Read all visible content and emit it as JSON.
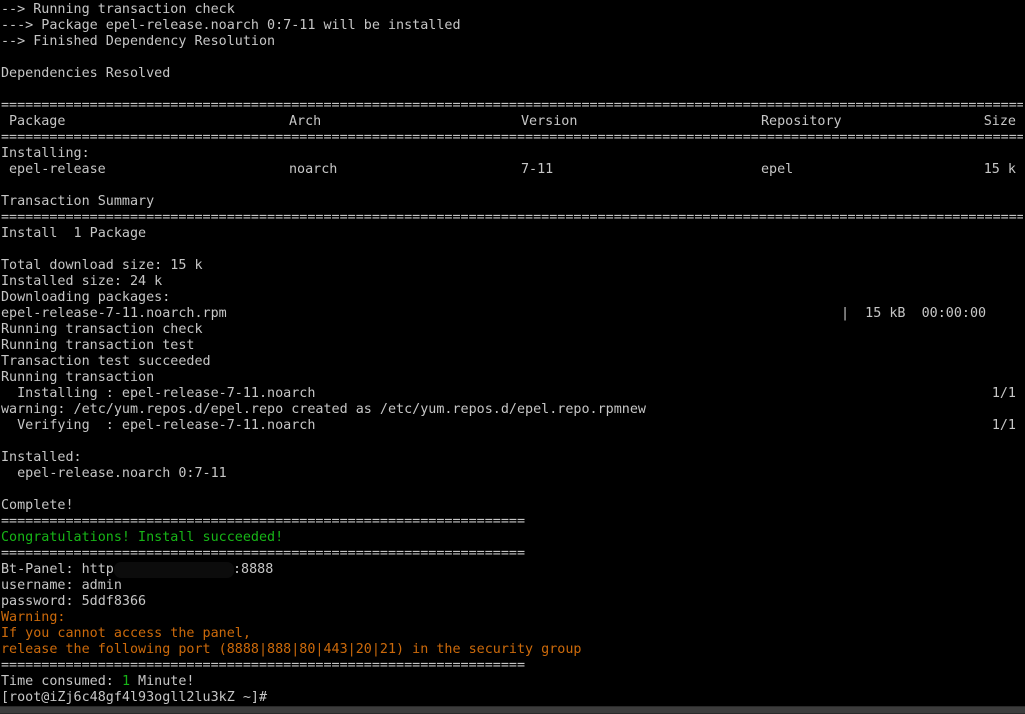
{
  "terminal": {
    "lines": {
      "l1": "--> Running transaction check",
      "l2": "---> Package epel-release.noarch 0:7-11 will be installed",
      "l3": "--> Finished Dependency Resolution",
      "l4": "Dependencies Resolved",
      "rule_double": "================================================================================================================================================================",
      "rule_short": "=================================================================",
      "installing_hdr": "Installing:",
      "transaction_summary": "Transaction Summary",
      "install_count": "Install  1 Package",
      "total_download": "Total download size: 15 k",
      "installed_size": "Installed size: 24 k",
      "downloading": "Downloading packages:",
      "rpm_file": "epel-release-7-11.noarch.rpm",
      "rpm_progress": "|  15 kB  00:00:00",
      "run_check": "Running transaction check",
      "run_test": "Running transaction test",
      "test_ok": "Transaction test succeeded",
      "running": "Running transaction",
      "installing_pkg": "  Installing : epel-release-7-11.noarch",
      "installing_step": "1/1",
      "warning_repo": "warning: /etc/yum.repos.d/epel.repo created as /etc/yum.repos.d/epel.repo.rpmnew",
      "verifying_pkg": "  Verifying  : epel-release-7-11.noarch",
      "verifying_step": "1/1",
      "installed_hdr": "Installed:",
      "installed_pkg": "  epel-release.noarch 0:7-11",
      "complete": "Complete!",
      "congrats": "Congratulations! Install succeeded!",
      "bt_panel_prefix": "Bt-Panel: http",
      "bt_panel_port": ":8888",
      "username": "username: admin",
      "password": "password: 5ddf8366",
      "warning_label": "Warning:",
      "warning_line1": "If you cannot access the panel,",
      "warning_line2": "release the following port (8888|888|80|443|20|21) in the security group",
      "time_prefix": "Time consumed: ",
      "time_value": "1",
      "time_suffix": " Minute!",
      "prompt": "[root@iZj6c48gf4l93ogll2lu3kZ ~]#"
    },
    "table": {
      "headers": {
        "package": "Package",
        "arch": "Arch",
        "version": "Version",
        "repository": "Repository",
        "size": "Size"
      },
      "row": {
        "package": "epel-release",
        "arch": "noarch",
        "version": "7-11",
        "repository": "epel",
        "size": "15 k"
      }
    }
  },
  "colors": {
    "background": "#000000",
    "text": "#c6c6c6",
    "success_green": "#17b517",
    "warning_orange": "#cc6a0b"
  }
}
